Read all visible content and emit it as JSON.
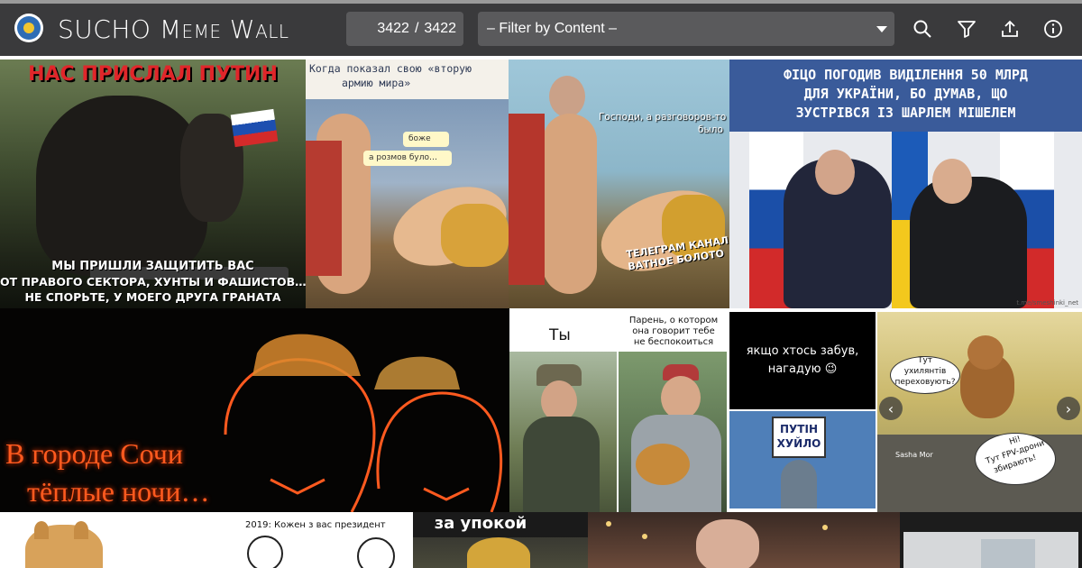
{
  "app": {
    "title": "SUCHO Meme Wall"
  },
  "header": {
    "counter_current": "3422",
    "counter_sep": "/",
    "counter_total": "3422",
    "filter_label": "– Filter by Content –",
    "icons": [
      "search-icon",
      "filter-icon",
      "upload-icon",
      "info-icon"
    ]
  },
  "tiles": {
    "t1": {
      "top": "НАС ПРИСЛАЛ ПУТИН",
      "bottom1": "МЫ ПРИШЛИ ЗАЩИТИТЬ ВАС",
      "bottom2": "ОТ ПРАВОГО СЕКТОРА, ХУНТЫ И ФАШИСТОВ…",
      "bottom3": "НЕ СПОРЬТЕ, У МОЕГО ДРУГА ГРАНАТА"
    },
    "t2": {
      "caption1": "Когда показал свою «вторую",
      "caption2": "армию мира»",
      "bubble1": "боже",
      "bubble2": "а розмов було…"
    },
    "t3": {
      "caption1": "Господи, а разговоров-то",
      "caption2": "было",
      "footer1": "ТЕЛЕГРАМ КАНАЛ",
      "footer2": "ВАТНОЕ БОЛОТО"
    },
    "t4": {
      "line1": "ФІЦО ПОГОДИВ ВИДІЛЕННЯ 50 МЛРД",
      "line2": "ДЛЯ УКРАЇНИ, БО ДУМАВ, ЩО",
      "line3": "ЗУСТРІВСЯ ІЗ ШАРЛЕМ МІШЕЛЕМ",
      "credit": "t.me/smeshinki_net"
    },
    "t5": {
      "line1": "В городе Сочи",
      "line2": "тёплые ночи…"
    },
    "t6": {
      "left": "Ты",
      "right1": "Парень, о котором",
      "right2": "она говорит тебе",
      "right3": "не беспокоиться"
    },
    "t7": {
      "line1": "якщо хтось забув,",
      "line2": "нагадую 😉",
      "sign1": "ПУТІН",
      "sign2": "ХУЙЛО"
    },
    "t8": {
      "bubble1a": "Тут",
      "bubble1b": "ухилянтів",
      "bubble1c": "переховують?",
      "bubble2a": "Ні!",
      "bubble2b": "Тут FPV-дрони",
      "bubble2c": "збирають!",
      "credit": "Sasha Mor",
      "arrow_left": "‹",
      "arrow_right": "›"
    },
    "t10": {
      "caption": "2019: Кожен з вас президент"
    },
    "t11": {
      "caption": "за упокой"
    }
  },
  "colors": {
    "header_bg": "#3a3a3c",
    "field_bg": "#5a5a5c",
    "neon": "#ff5a1f"
  }
}
